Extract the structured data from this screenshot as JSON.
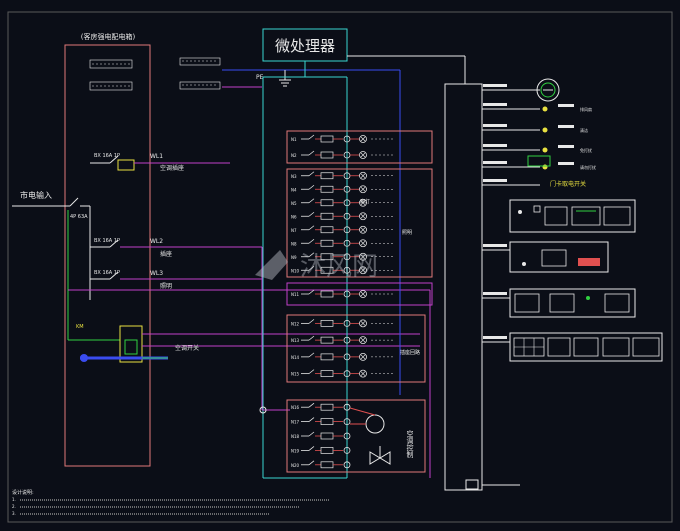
{
  "title": "微处理器",
  "panel_title": "(客房强电配电箱)",
  "mains_label": "市电输入",
  "ground_label": "PE",
  "contactor_label": "KM",
  "left_block": {
    "mcb_label": "4P 63A",
    "breakers": [
      "BX 16A 1P",
      "BX 16A 1P",
      "BX 16A 1P"
    ],
    "circuit_tags": [
      "WL1",
      "WL2",
      "WL3"
    ],
    "circuit_notes": [
      "空调插座",
      "插座",
      "照明"
    ],
    "load_label": "空调开关"
  },
  "group_labels": [
    "廊灯",
    "照明",
    "插座回路",
    "空调控制"
  ],
  "circuit_groups": [
    [
      "N1",
      "N2"
    ],
    [
      "N3",
      "N4",
      "N5",
      "N6",
      "N7",
      "N8",
      "N9",
      "N10"
    ],
    [
      "N11"
    ],
    [
      "N12",
      "N13",
      "N14",
      "N15"
    ],
    [
      "N16",
      "N17",
      "N18",
      "N19",
      "N20"
    ]
  ],
  "right_panel": {
    "label": "门卡取电开关",
    "rows": [
      "排风扇",
      "清洁",
      "免打扰",
      "请勿打扰"
    ]
  },
  "watermark": "沐风网",
  "notes": [
    "设计说明:",
    "1.",
    "2.",
    "3."
  ],
  "colors": {
    "cyan": "#38d7d0",
    "magenta": "#c040c8",
    "blue": "#3a4cf0",
    "red": "#e05050",
    "salmon": "#e07878",
    "yellow": "#e8e040",
    "white": "#e8e8e8",
    "green": "#30d040"
  }
}
